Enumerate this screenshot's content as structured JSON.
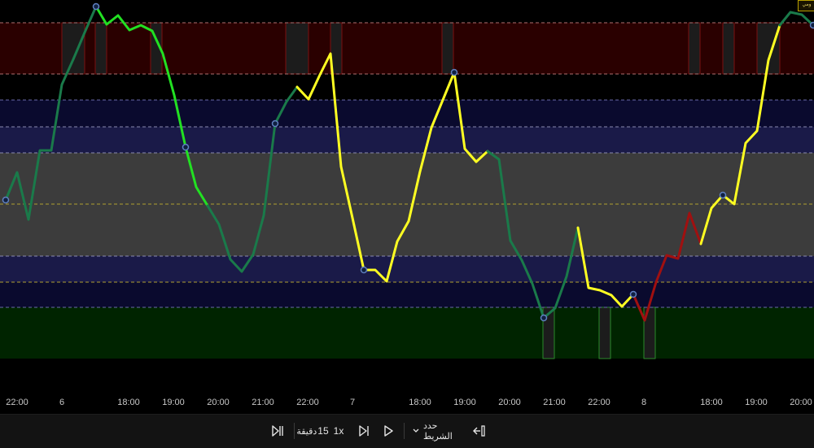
{
  "chart": {
    "series_colors": {
      "green_dark": "#1a7a4a",
      "green_bright": "#22e022",
      "yellow": "#ffff22",
      "red": "#a01010"
    },
    "zone_colors": {
      "overbought": "#2a0000",
      "upper": "#0a0a2e",
      "upper_inner": "#1a1a48",
      "neutral": "#3c3c3c",
      "lower_inner": "#1a1a48",
      "lower": "#0a0a2e",
      "oversold": "#002400"
    }
  },
  "time_axis": {
    "labels": [
      "22:00",
      "6",
      "18:00",
      "19:00",
      "20:00",
      "21:00",
      "22:00",
      "7",
      "18:00",
      "19:00",
      "20:00",
      "21:00",
      "22:00",
      "8",
      "18:00",
      "19:00",
      "20:00"
    ]
  },
  "replay": {
    "play_label": "play",
    "step_label": "step-forward",
    "speed": "1x",
    "interval": "15",
    "interval_unit": "دقيقة",
    "select_bar": "حدد الشريط",
    "jump_label": "jump-to-realtime"
  },
  "corner_badge": "ومي"
}
